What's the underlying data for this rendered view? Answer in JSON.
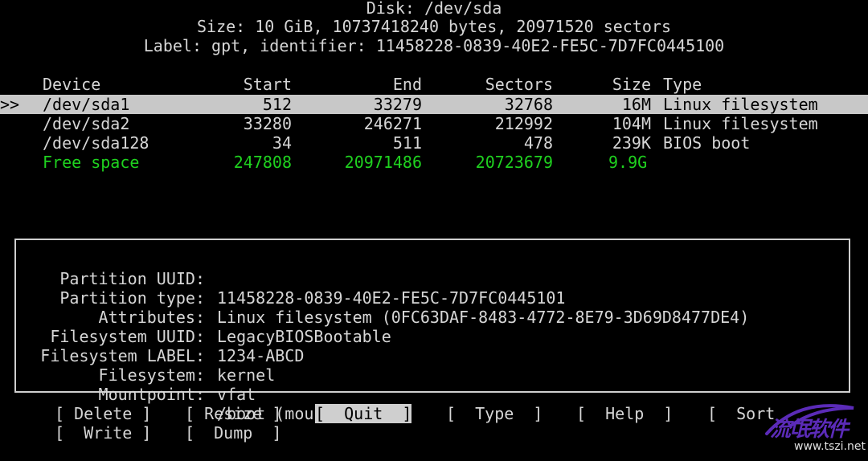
{
  "disk": {
    "title": "Disk: /dev/sda",
    "size_line": "Size: 10 GiB, 10737418240 bytes, 20971520 sectors",
    "label_line": "Label: gpt, identifier: 11458228-0839-40E2-FE5C-7D7FC0445100"
  },
  "table": {
    "headers": {
      "device": "Device",
      "start": "Start",
      "end": "End",
      "sectors": "Sectors",
      "size": "Size",
      "type": "Type"
    },
    "selector": ">>",
    "rows": [
      {
        "device": "/dev/sda1",
        "start": "512",
        "end": "33279",
        "sectors": "32768",
        "size": "16M",
        "type": "Linux filesystem"
      },
      {
        "device": "/dev/sda2",
        "start": "33280",
        "end": "246271",
        "sectors": "212992",
        "size": "104M",
        "type": "Linux filesystem"
      },
      {
        "device": "/dev/sda128",
        "start": "34",
        "end": "511",
        "sectors": "478",
        "size": "239K",
        "type": "BIOS boot"
      },
      {
        "device": "Free space",
        "start": "247808",
        "end": "20971486",
        "sectors": "20723679",
        "size": "9.9G",
        "type": ""
      }
    ]
  },
  "details": [
    {
      "label": "Partition UUID:",
      "value": "11458228-0839-40E2-FE5C-7D7FC0445101"
    },
    {
      "label": "Partition type:",
      "value": "Linux filesystem (0FC63DAF-8483-4772-8E79-3D69D8477DE4)"
    },
    {
      "label": "Attributes:",
      "value": "LegacyBIOSBootable"
    },
    {
      "label": "Filesystem UUID:",
      "value": "1234-ABCD"
    },
    {
      "label": "Filesystem LABEL:",
      "value": "kernel"
    },
    {
      "label": "Filesystem:",
      "value": "vfat"
    },
    {
      "label": "Mountpoint:",
      "value": "/boot (mounted)"
    }
  ],
  "menu": {
    "delete": "[ Delete ]",
    "resize": "[ Resize ]",
    "quit": "[  Quit  ]",
    "type": "[  Type  ]",
    "help": "[  Help  ]",
    "sort": "[  Sort",
    "write": "[  Write ]",
    "dump": "[  Dump  ]"
  },
  "watermark": {
    "line1": "流氓软件",
    "line2": "www.tszi.net"
  },
  "colors": {
    "background": "#000000",
    "text": "#d6d6d6",
    "selection": "#c8c8c8",
    "free_space": "#1fd11f"
  }
}
